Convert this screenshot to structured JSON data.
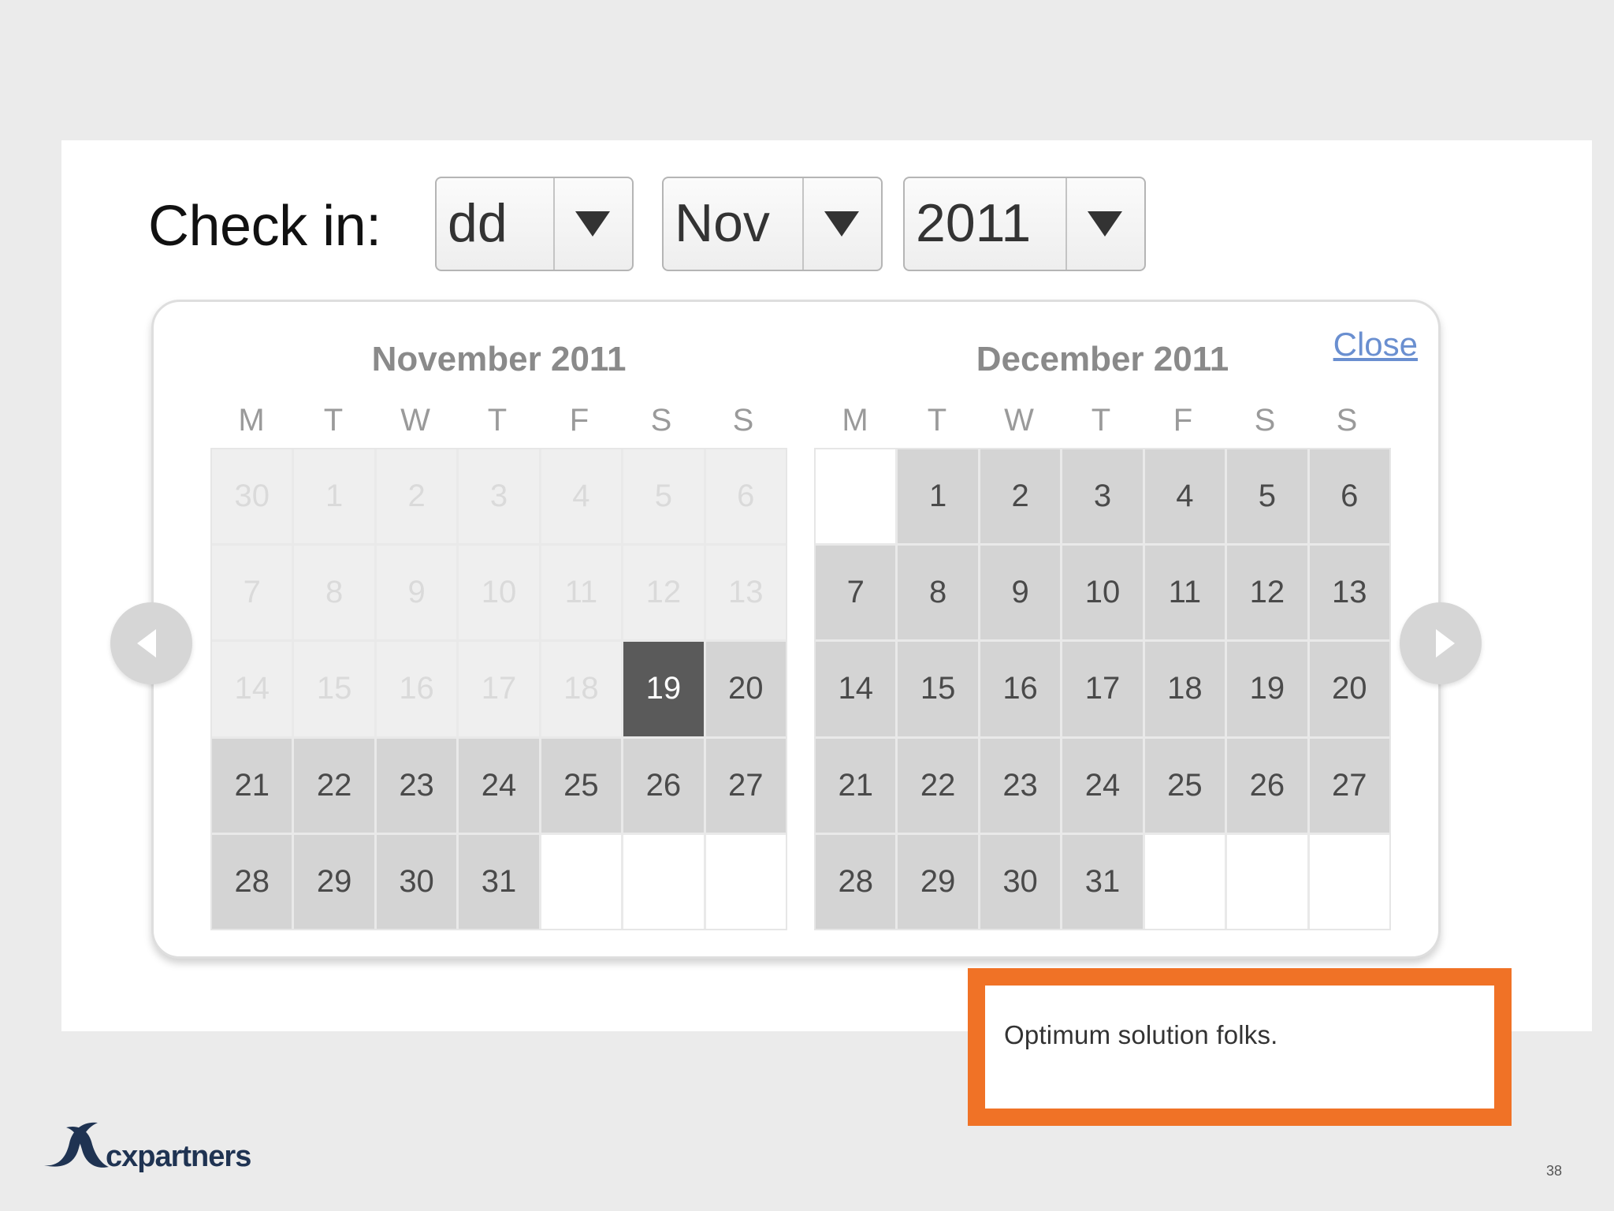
{
  "checkin": {
    "label": "Check in:",
    "day_select": "dd",
    "month_select": "Nov",
    "year_select": "2011"
  },
  "calendar": {
    "close_label": "Close",
    "weekdays": [
      "M",
      "T",
      "W",
      "T",
      "F",
      "S",
      "S"
    ],
    "months": [
      {
        "title": "November 2011",
        "weeks": [
          [
            "30",
            "1",
            "2",
            "3",
            "4",
            "5",
            "6"
          ],
          [
            "7",
            "8",
            "9",
            "10",
            "11",
            "12",
            "13"
          ],
          [
            "14",
            "15",
            "16",
            "17",
            "18",
            "19",
            "20"
          ],
          [
            "21",
            "22",
            "23",
            "24",
            "25",
            "26",
            "27"
          ],
          [
            "28",
            "29",
            "30",
            "31",
            "",
            "",
            ""
          ]
        ],
        "states": [
          [
            "disabled",
            "disabled",
            "disabled",
            "disabled",
            "disabled",
            "disabled",
            "disabled"
          ],
          [
            "disabled",
            "disabled",
            "disabled",
            "disabled",
            "disabled",
            "disabled",
            "disabled"
          ],
          [
            "disabled",
            "disabled",
            "disabled",
            "disabled",
            "disabled",
            "selected",
            "available"
          ],
          [
            "available",
            "available",
            "available",
            "available",
            "available",
            "available",
            "available"
          ],
          [
            "available",
            "available",
            "available",
            "available",
            "empty",
            "empty",
            "empty"
          ]
        ]
      },
      {
        "title": "December 2011",
        "weeks": [
          [
            "",
            "1",
            "2",
            "3",
            "4",
            "5",
            "6"
          ],
          [
            "7",
            "8",
            "9",
            "10",
            "11",
            "12",
            "13"
          ],
          [
            "14",
            "15",
            "16",
            "17",
            "18",
            "19",
            "20"
          ],
          [
            "21",
            "22",
            "23",
            "24",
            "25",
            "26",
            "27"
          ],
          [
            "28",
            "29",
            "30",
            "31",
            "",
            "",
            ""
          ]
        ],
        "states": [
          [
            "empty",
            "available",
            "available",
            "available",
            "available",
            "available",
            "available"
          ],
          [
            "available",
            "available",
            "available",
            "available",
            "available",
            "available",
            "available"
          ],
          [
            "available",
            "available",
            "available",
            "available",
            "available",
            "available",
            "available"
          ],
          [
            "available",
            "available",
            "available",
            "available",
            "available",
            "available",
            "available"
          ],
          [
            "available",
            "available",
            "available",
            "available",
            "empty",
            "empty",
            "empty"
          ]
        ]
      }
    ]
  },
  "icons": {
    "prev": "chevron-left-icon",
    "next": "chevron-right-icon",
    "dropdown": "triangle-down-icon"
  },
  "note": {
    "text": "Optimum solution folks."
  },
  "footer": {
    "logo_text": "cxpartners",
    "page_number": "38"
  },
  "colors": {
    "accent_orange": "#f07226",
    "selected_day": "#5a5a5a",
    "available_day": "#d4d4d4",
    "disabled_day": "#efefef",
    "link": "#6a8fd0",
    "logo_navy": "#1f3352"
  }
}
